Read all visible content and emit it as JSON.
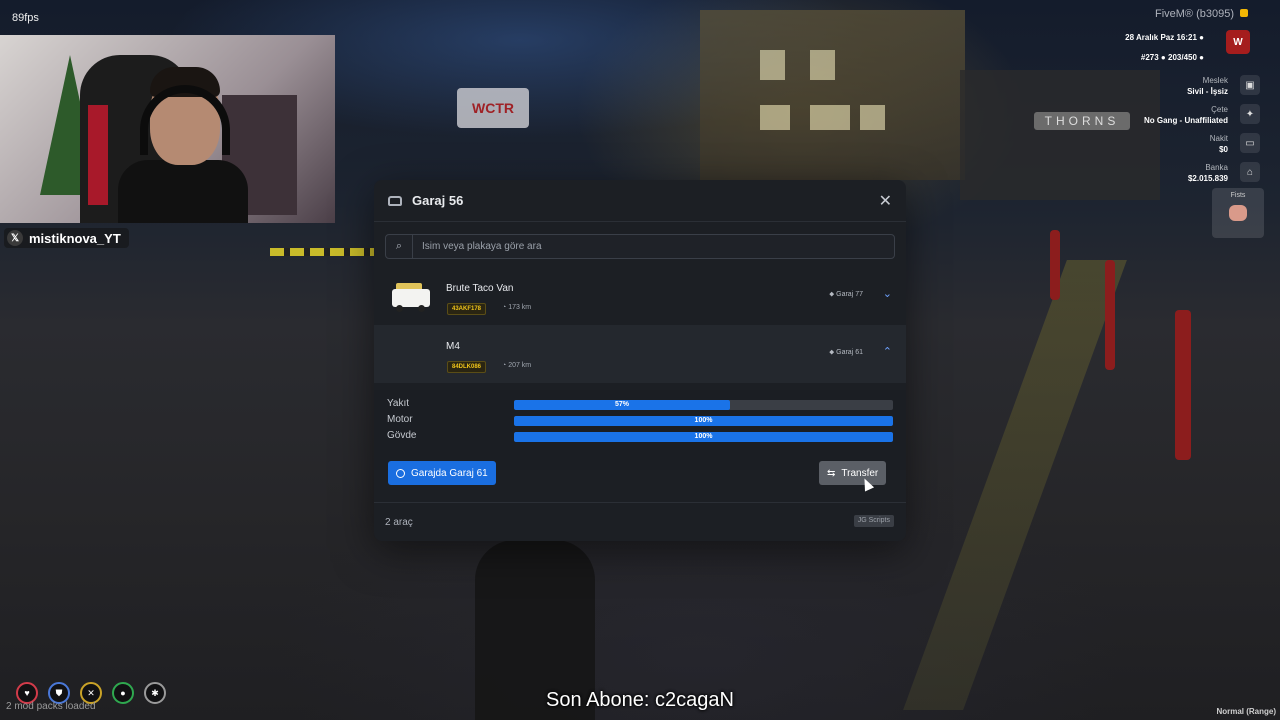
{
  "hud": {
    "fps": "89fps",
    "webcam_handle": "mistiknova_YT",
    "server": "FiveM® (b3095)",
    "datetime": "28 Aralık Paz 16:21",
    "player_id": "#273",
    "players": "203/450",
    "job_label": "Meslek",
    "job_value": "Sivil - İşsiz",
    "gang_label": "Çete",
    "gang_value": "No Gang - Unaffiliated",
    "cash_label": "Nakit",
    "cash_value": "$0",
    "bank_label": "Banka",
    "bank_value": "$2.015.839",
    "weapon_label": "Fists",
    "mods_text": "2 mod packs loaded",
    "subtitle": "Son Abone: c2cagaN",
    "voice_mode": "Normal (Range)",
    "status_colors": [
      "#d23b4a",
      "#4a78d8",
      "#c9a227",
      "#2fa84f",
      "#9a9a9a"
    ]
  },
  "garage": {
    "title": "Garaj 56",
    "search_placeholder": "İsim veya plakaya göre ara",
    "vehicles": [
      {
        "name": "Brute Taco Van",
        "plate": "43AKF178",
        "km": "173 km",
        "garage": "Garaj 77"
      },
      {
        "name": "M4",
        "plate": "84DLK086",
        "km": "207 km",
        "garage": "Garaj 61"
      }
    ],
    "stats": [
      {
        "label": "Yakıt",
        "value_text": "57%",
        "value": 0.57
      },
      {
        "label": "Motor",
        "value_text": "100%",
        "value": 1.0
      },
      {
        "label": "Gövde",
        "value_text": "100%",
        "value": 1.0
      }
    ],
    "garage_button": "Garajda Garaj 61",
    "transfer_button": "Transfer",
    "count": "2 araç",
    "brand": "JG Scripts"
  }
}
